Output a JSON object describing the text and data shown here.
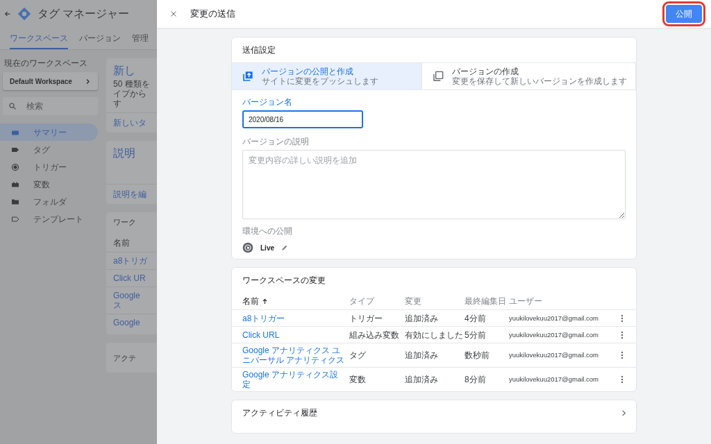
{
  "background": {
    "app_title": "タグ マネージャー",
    "tabs": [
      {
        "label": "ワークスペース",
        "selected": true
      },
      {
        "label": "バージョン",
        "selected": false
      },
      {
        "label": "管理",
        "selected": false
      }
    ],
    "workspace_label": "現在のワークスペース",
    "workspace_name": "Default Workspace",
    "search_placeholder": "検索",
    "nav": [
      {
        "label": "サマリー",
        "selected": true
      },
      {
        "label": "タグ",
        "selected": false
      },
      {
        "label": "トリガー",
        "selected": false
      },
      {
        "label": "変数",
        "selected": false
      },
      {
        "label": "フォルダ",
        "selected": false
      },
      {
        "label": "テンプレート",
        "selected": false
      }
    ],
    "cards": [
      {
        "kind": "promo",
        "title": "新し",
        "lines": [
          "50 種類を",
          "イプから",
          "す"
        ],
        "link": "新しいタ"
      },
      {
        "kind": "description",
        "title": "説明",
        "link": "説明を編"
      },
      {
        "kind": "table",
        "title": "ワーク",
        "header": "名前",
        "rows": [
          [
            "a8トリガ"
          ],
          [
            "Click UR"
          ],
          [
            "Google",
            "ス"
          ],
          [
            "Google"
          ]
        ]
      },
      {
        "kind": "plain",
        "title": "アクテ"
      }
    ]
  },
  "dialog": {
    "title": "変更の送信",
    "publish_button": {
      "label": "公開",
      "highlighted": true
    },
    "submission": {
      "title": "送信設定",
      "options": [
        {
          "title": "バージョンの公開と作成",
          "subtitle": "サイトに変更をプッシュします",
          "selected": true
        },
        {
          "title": "バージョンの作成",
          "subtitle": "変更を保存して新しいバージョンを作成します",
          "selected": false
        }
      ],
      "version_name_label": "バージョン名",
      "version_name_value": "2020/08/16",
      "description_label": "バージョンの説明",
      "description_placeholder": "変更内容の詳しい説明を追加",
      "environment_label": "環境への公開",
      "environment": "Live"
    },
    "changes": {
      "title": "ワークスペースの変更",
      "columns": [
        {
          "label": "名前",
          "sorted": true
        },
        {
          "label": "タイプ",
          "sorted": false
        },
        {
          "label": "変更",
          "sorted": false
        },
        {
          "label": "最終編集日",
          "sorted": false
        },
        {
          "label": "ユーザー",
          "sorted": false
        }
      ],
      "rows": [
        {
          "name": "a8トリガー",
          "type": "トリガー",
          "change": "追加済み",
          "edited": "4分前",
          "user": "yuukilovekuu2017@gmail.com"
        },
        {
          "name": "Click URL",
          "type": "組み込み変数",
          "change": "有効にしました",
          "edited": "5分前",
          "user": "yuukilovekuu2017@gmail.com"
        },
        {
          "name": "Google アナリティクス ユニバーサル アナリティクス",
          "type": "タグ",
          "change": "追加済み",
          "edited": "数秒前",
          "user": "yuukilovekuu2017@gmail.com"
        },
        {
          "name": "Google アナリティクス設定",
          "type": "変数",
          "change": "追加済み",
          "edited": "8分前",
          "user": "yuukilovekuu2017@gmail.com"
        }
      ]
    },
    "activity": {
      "title": "アクティビティ履歴"
    }
  }
}
